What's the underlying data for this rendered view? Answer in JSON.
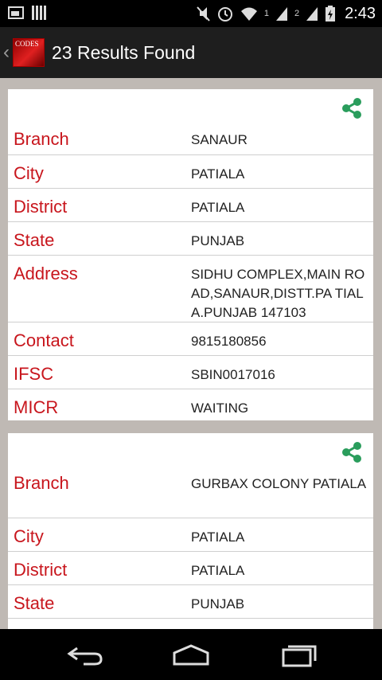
{
  "status_bar": {
    "time": "2:43",
    "sim1": "1",
    "sim2": "2"
  },
  "app_bar": {
    "logo_text": "CODES",
    "title": "23 Results Found"
  },
  "results": [
    {
      "fields": [
        {
          "label": "Branch",
          "value": "SANAUR"
        },
        {
          "label": "City",
          "value": "PATIALA"
        },
        {
          "label": "District",
          "value": "PATIALA"
        },
        {
          "label": "State",
          "value": "PUNJAB"
        },
        {
          "label": "Address",
          "value": "SIDHU COMPLEX,MAIN ROAD,SANAUR,DISTT.PA TIALA.PUNJAB 147103"
        },
        {
          "label": "Contact",
          "value": "9815180856"
        },
        {
          "label": "IFSC",
          "value": "SBIN0017016"
        },
        {
          "label": "MICR",
          "value": "WAITING"
        }
      ]
    },
    {
      "fields": [
        {
          "label": "Branch",
          "value": "GURBAX COLONY PATIALA"
        },
        {
          "label": "City",
          "value": "PATIALA"
        },
        {
          "label": "District",
          "value": "PATIALA"
        },
        {
          "label": "State",
          "value": "PUNJAB"
        }
      ]
    }
  ],
  "colors": {
    "label": "#c8161d",
    "share_icon": "#2a9d5c",
    "app_bar": "#1e1e1e",
    "background": "#bfb9b4"
  },
  "icons": {
    "share": "share-icon",
    "nav_back": "back-icon",
    "nav_home": "home-icon",
    "nav_recent": "recent-apps-icon"
  }
}
